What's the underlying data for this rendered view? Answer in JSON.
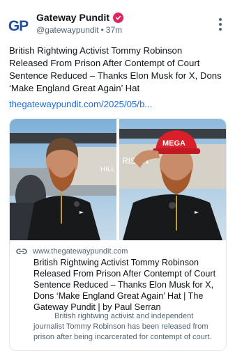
{
  "author": {
    "display_name": "Gateway Pundit",
    "avatar_text": "GP",
    "handle": "@gatewaypundit",
    "separator": "•",
    "time": "37m",
    "verified_color": "#e0245e"
  },
  "post": {
    "text": "British Rightwing Activist Tommy Robinson Released From Prison After Contempt of Court Sentence Reduced – Thanks Elon Musk for X, Dons ‘Make England Great Again’ Hat",
    "link": "thegatewaypundit.com/2025/05/b..."
  },
  "card": {
    "domain": "www.thegatewaypundit.com",
    "title": "British Rightwing Activist Tommy Robinson Released From Prison After Contempt of Court Sentence Reduced – Thanks Elon Musk for X, Dons ‘Make England Great Again’ Hat | The Gateway Pundit | by Paul Serran",
    "description": "British rightwing activist and independent journalist Tommy Robinson has been released from prison after being incarcerated for contempt of court.",
    "hat_text": "MEGA",
    "sign_text_left": "HILL",
    "sign_text_right": "RISON"
  },
  "icons": {
    "verified": "verified-badge-icon",
    "more": "more-vertical-icon",
    "link": "link-icon"
  },
  "colors": {
    "link": "#1d6ddf",
    "brand": "#1f4e9c",
    "muted": "#536471",
    "hat": "#d81f2a"
  }
}
